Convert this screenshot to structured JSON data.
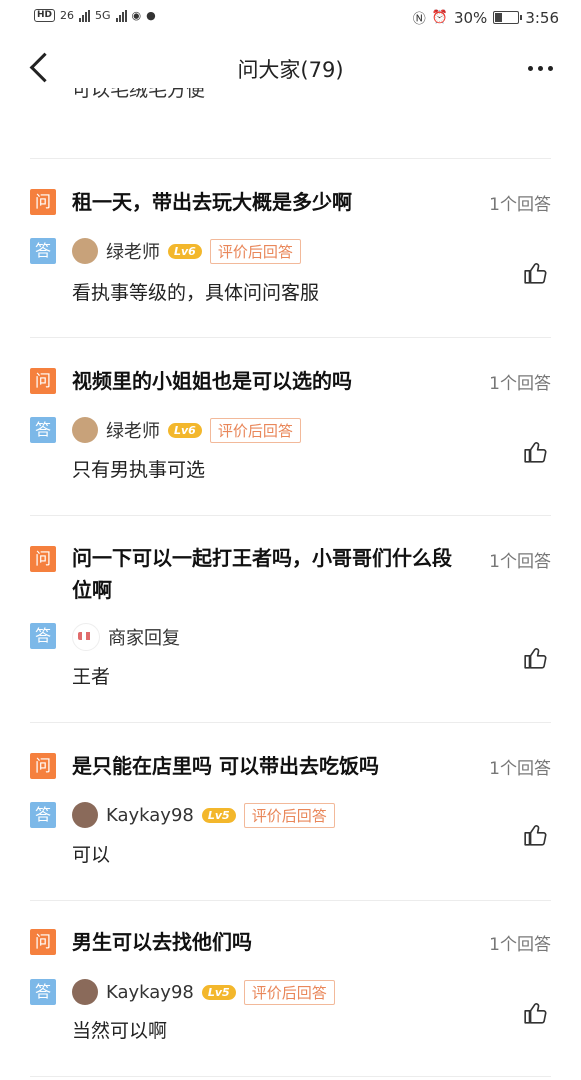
{
  "status": {
    "left_hd": "HD",
    "left_net1": "26",
    "left_net2": "5G",
    "battery": "30%",
    "battery_level": 0.3,
    "time": "3:56"
  },
  "nav": {
    "title": "问大家(79)"
  },
  "partial_text": "可以毛绒毛方便",
  "labels": {
    "q": "问",
    "a": "答"
  },
  "items": [
    {
      "question": "租一天，带出去玩大概是多少啊",
      "count": "1个回答",
      "user": "绿老师",
      "level": "Lv6",
      "badge": "评价后回答",
      "answer": "看执事等级的，具体问问客服"
    },
    {
      "question": "视频里的小姐姐也是可以选的吗",
      "count": "1个回答",
      "user": "绿老师",
      "level": "Lv6",
      "badge": "评价后回答",
      "answer": "只有男执事可选"
    },
    {
      "question": "问一下可以一起打王者吗，小哥哥们什么段位啊",
      "count": "1个回答",
      "user": "商家回复",
      "answer": "王者"
    },
    {
      "question": "是只能在店里吗 可以带出去吃饭吗",
      "count": "1个回答",
      "user": "Kaykay98",
      "level": "Lv5",
      "badge": "评价后回答",
      "answer": "可以"
    },
    {
      "question": "男生可以去找他们吗",
      "count": "1个回答",
      "user": "Kaykay98",
      "level": "Lv5",
      "badge": "评价后回答",
      "answer": "当然可以啊"
    }
  ]
}
